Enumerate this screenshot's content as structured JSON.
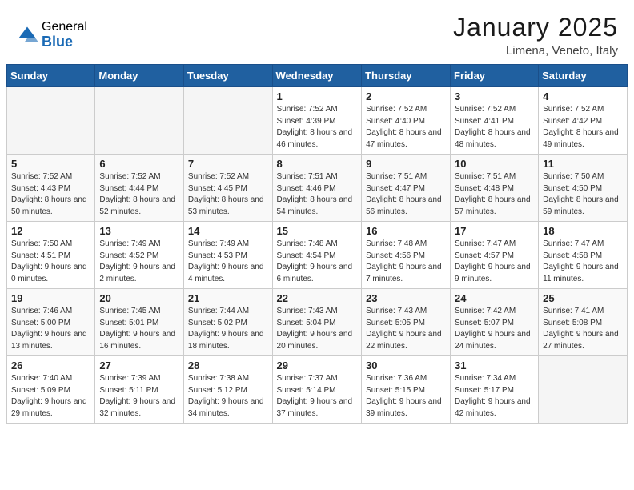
{
  "logo": {
    "general": "General",
    "blue": "Blue"
  },
  "title": "January 2025",
  "location": "Limena, Veneto, Italy",
  "days_of_week": [
    "Sunday",
    "Monday",
    "Tuesday",
    "Wednesday",
    "Thursday",
    "Friday",
    "Saturday"
  ],
  "weeks": [
    [
      {
        "day": "",
        "sunrise": "",
        "sunset": "",
        "daylight": ""
      },
      {
        "day": "",
        "sunrise": "",
        "sunset": "",
        "daylight": ""
      },
      {
        "day": "",
        "sunrise": "",
        "sunset": "",
        "daylight": ""
      },
      {
        "day": "1",
        "sunrise": "Sunrise: 7:52 AM",
        "sunset": "Sunset: 4:39 PM",
        "daylight": "Daylight: 8 hours and 46 minutes."
      },
      {
        "day": "2",
        "sunrise": "Sunrise: 7:52 AM",
        "sunset": "Sunset: 4:40 PM",
        "daylight": "Daylight: 8 hours and 47 minutes."
      },
      {
        "day": "3",
        "sunrise": "Sunrise: 7:52 AM",
        "sunset": "Sunset: 4:41 PM",
        "daylight": "Daylight: 8 hours and 48 minutes."
      },
      {
        "day": "4",
        "sunrise": "Sunrise: 7:52 AM",
        "sunset": "Sunset: 4:42 PM",
        "daylight": "Daylight: 8 hours and 49 minutes."
      }
    ],
    [
      {
        "day": "5",
        "sunrise": "Sunrise: 7:52 AM",
        "sunset": "Sunset: 4:43 PM",
        "daylight": "Daylight: 8 hours and 50 minutes."
      },
      {
        "day": "6",
        "sunrise": "Sunrise: 7:52 AM",
        "sunset": "Sunset: 4:44 PM",
        "daylight": "Daylight: 8 hours and 52 minutes."
      },
      {
        "day": "7",
        "sunrise": "Sunrise: 7:52 AM",
        "sunset": "Sunset: 4:45 PM",
        "daylight": "Daylight: 8 hours and 53 minutes."
      },
      {
        "day": "8",
        "sunrise": "Sunrise: 7:51 AM",
        "sunset": "Sunset: 4:46 PM",
        "daylight": "Daylight: 8 hours and 54 minutes."
      },
      {
        "day": "9",
        "sunrise": "Sunrise: 7:51 AM",
        "sunset": "Sunset: 4:47 PM",
        "daylight": "Daylight: 8 hours and 56 minutes."
      },
      {
        "day": "10",
        "sunrise": "Sunrise: 7:51 AM",
        "sunset": "Sunset: 4:48 PM",
        "daylight": "Daylight: 8 hours and 57 minutes."
      },
      {
        "day": "11",
        "sunrise": "Sunrise: 7:50 AM",
        "sunset": "Sunset: 4:50 PM",
        "daylight": "Daylight: 8 hours and 59 minutes."
      }
    ],
    [
      {
        "day": "12",
        "sunrise": "Sunrise: 7:50 AM",
        "sunset": "Sunset: 4:51 PM",
        "daylight": "Daylight: 9 hours and 0 minutes."
      },
      {
        "day": "13",
        "sunrise": "Sunrise: 7:49 AM",
        "sunset": "Sunset: 4:52 PM",
        "daylight": "Daylight: 9 hours and 2 minutes."
      },
      {
        "day": "14",
        "sunrise": "Sunrise: 7:49 AM",
        "sunset": "Sunset: 4:53 PM",
        "daylight": "Daylight: 9 hours and 4 minutes."
      },
      {
        "day": "15",
        "sunrise": "Sunrise: 7:48 AM",
        "sunset": "Sunset: 4:54 PM",
        "daylight": "Daylight: 9 hours and 6 minutes."
      },
      {
        "day": "16",
        "sunrise": "Sunrise: 7:48 AM",
        "sunset": "Sunset: 4:56 PM",
        "daylight": "Daylight: 9 hours and 7 minutes."
      },
      {
        "day": "17",
        "sunrise": "Sunrise: 7:47 AM",
        "sunset": "Sunset: 4:57 PM",
        "daylight": "Daylight: 9 hours and 9 minutes."
      },
      {
        "day": "18",
        "sunrise": "Sunrise: 7:47 AM",
        "sunset": "Sunset: 4:58 PM",
        "daylight": "Daylight: 9 hours and 11 minutes."
      }
    ],
    [
      {
        "day": "19",
        "sunrise": "Sunrise: 7:46 AM",
        "sunset": "Sunset: 5:00 PM",
        "daylight": "Daylight: 9 hours and 13 minutes."
      },
      {
        "day": "20",
        "sunrise": "Sunrise: 7:45 AM",
        "sunset": "Sunset: 5:01 PM",
        "daylight": "Daylight: 9 hours and 16 minutes."
      },
      {
        "day": "21",
        "sunrise": "Sunrise: 7:44 AM",
        "sunset": "Sunset: 5:02 PM",
        "daylight": "Daylight: 9 hours and 18 minutes."
      },
      {
        "day": "22",
        "sunrise": "Sunrise: 7:43 AM",
        "sunset": "Sunset: 5:04 PM",
        "daylight": "Daylight: 9 hours and 20 minutes."
      },
      {
        "day": "23",
        "sunrise": "Sunrise: 7:43 AM",
        "sunset": "Sunset: 5:05 PM",
        "daylight": "Daylight: 9 hours and 22 minutes."
      },
      {
        "day": "24",
        "sunrise": "Sunrise: 7:42 AM",
        "sunset": "Sunset: 5:07 PM",
        "daylight": "Daylight: 9 hours and 24 minutes."
      },
      {
        "day": "25",
        "sunrise": "Sunrise: 7:41 AM",
        "sunset": "Sunset: 5:08 PM",
        "daylight": "Daylight: 9 hours and 27 minutes."
      }
    ],
    [
      {
        "day": "26",
        "sunrise": "Sunrise: 7:40 AM",
        "sunset": "Sunset: 5:09 PM",
        "daylight": "Daylight: 9 hours and 29 minutes."
      },
      {
        "day": "27",
        "sunrise": "Sunrise: 7:39 AM",
        "sunset": "Sunset: 5:11 PM",
        "daylight": "Daylight: 9 hours and 32 minutes."
      },
      {
        "day": "28",
        "sunrise": "Sunrise: 7:38 AM",
        "sunset": "Sunset: 5:12 PM",
        "daylight": "Daylight: 9 hours and 34 minutes."
      },
      {
        "day": "29",
        "sunrise": "Sunrise: 7:37 AM",
        "sunset": "Sunset: 5:14 PM",
        "daylight": "Daylight: 9 hours and 37 minutes."
      },
      {
        "day": "30",
        "sunrise": "Sunrise: 7:36 AM",
        "sunset": "Sunset: 5:15 PM",
        "daylight": "Daylight: 9 hours and 39 minutes."
      },
      {
        "day": "31",
        "sunrise": "Sunrise: 7:34 AM",
        "sunset": "Sunset: 5:17 PM",
        "daylight": "Daylight: 9 hours and 42 minutes."
      },
      {
        "day": "",
        "sunrise": "",
        "sunset": "",
        "daylight": ""
      }
    ]
  ]
}
